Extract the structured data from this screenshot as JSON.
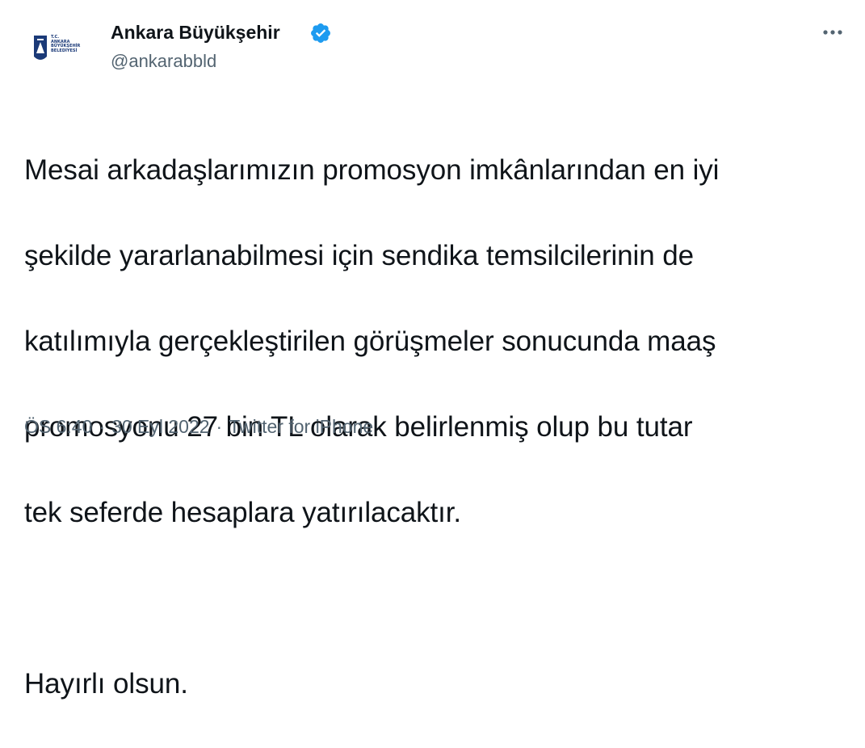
{
  "account": {
    "display_name": "Ankara Büyükşehir",
    "handle": "@ankarabbld",
    "verified": true,
    "avatar_logo_lines": [
      "T.C.",
      "ANKARA",
      "BÜYÜKŞEHİR",
      "BELEDİYESİ"
    ],
    "avatar_icon": "ankara-municipality-logo",
    "verified_icon": "verified-badge-icon"
  },
  "tweet": {
    "paragraph_1_lines": [
      "Mesai arkadaşlarımızın promosyon imkânlarından en iyi",
      "şekilde yararlanabilmesi için sendika temsilcilerinin de",
      "katılımıyla gerçekleştirilen görüşmeler sonucunda maaş",
      "promosyonu 27 bin TL olarak belirlenmiş olup bu tutar",
      "tek seferde hesaplara yatırılacaktır."
    ],
    "paragraph_2": "Hayırlı olsun."
  },
  "meta": {
    "time": "ÖS 6:40",
    "date": "30 Eyl 2022",
    "source": "Twitter for iPhone",
    "separator": "·"
  },
  "more_icon": "more-options-icon",
  "colors": {
    "text": "#0f1419",
    "secondary": "#536471",
    "verified": "#1d9bf0",
    "logo_blue": "#1b3a78"
  }
}
